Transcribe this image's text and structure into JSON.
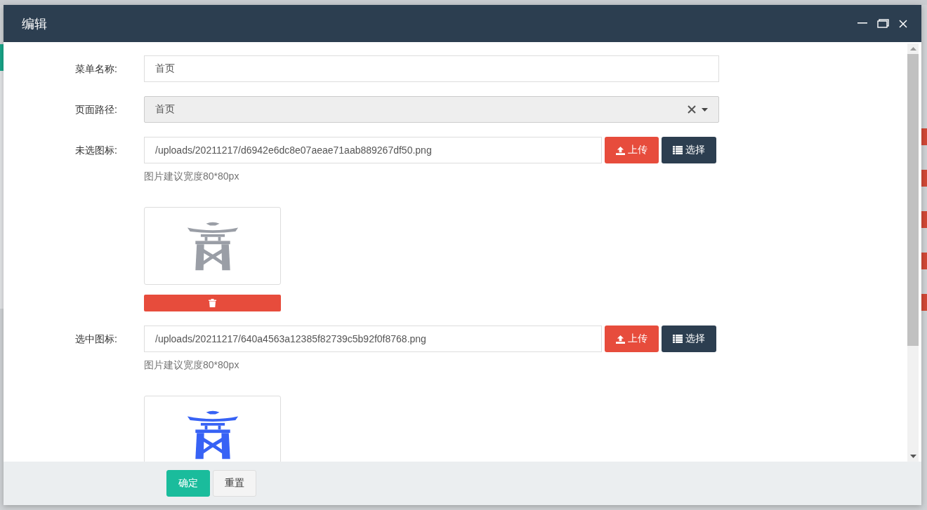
{
  "dialog": {
    "title": "编辑"
  },
  "fields": [
    {
      "kind": "text",
      "label": "菜单名称:",
      "value": "首页"
    },
    {
      "kind": "select",
      "label": "页面路径:",
      "value": "首页"
    },
    {
      "kind": "image",
      "label": "未选图标:",
      "value": "/uploads/20211217/d6942e6dc8e07aeae71aab889267df50.png",
      "upload": "上传",
      "choose": "选择",
      "hint": "图片建议宽度80*80px",
      "color": "#9a9ea6",
      "delete_button": true
    },
    {
      "kind": "image",
      "label": "选中图标:",
      "value": "/uploads/20211217/640a4563a12385f82739c5b92f0f8768.png",
      "upload": "上传",
      "choose": "选择",
      "hint": "图片建议宽度80*80px",
      "color": "#3762f5",
      "delete_button": false
    }
  ],
  "footer": {
    "buttons": [
      {
        "label": "确定",
        "kind": "primary"
      },
      {
        "label": "重置",
        "kind": "default"
      }
    ]
  }
}
